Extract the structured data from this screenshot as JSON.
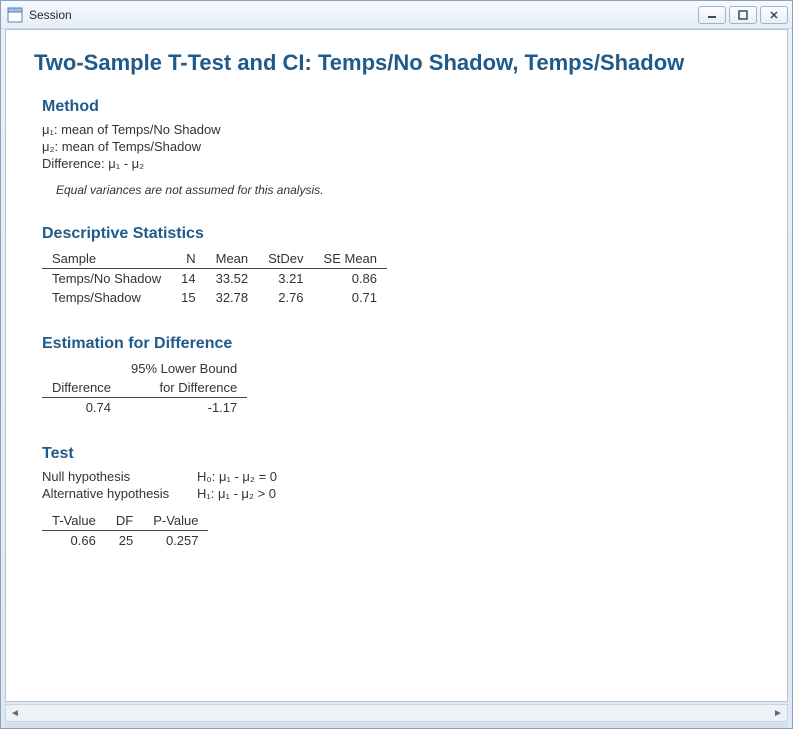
{
  "window": {
    "title": "Session"
  },
  "main_title": "Two-Sample T-Test and CI: Temps/No Shadow, Temps/Shadow",
  "method": {
    "heading": "Method",
    "mu1": "μ₁: mean of Temps/No Shadow",
    "mu2": "μ₂: mean of Temps/Shadow",
    "diff": "Difference: μ₁ - μ₂",
    "note": "Equal variances are not assumed for this analysis."
  },
  "descriptive": {
    "heading": "Descriptive Statistics",
    "headers": {
      "sample": "Sample",
      "n": "N",
      "mean": "Mean",
      "stdev": "StDev",
      "semean": "SE Mean"
    },
    "rows": [
      {
        "sample": "Temps/No Shadow",
        "n": "14",
        "mean": "33.52",
        "stdev": "3.21",
        "semean": "0.86"
      },
      {
        "sample": "Temps/Shadow",
        "n": "15",
        "mean": "32.78",
        "stdev": "2.76",
        "semean": "0.71"
      }
    ]
  },
  "estimation": {
    "heading": "Estimation for Difference",
    "h1": "Difference",
    "h2a": "95% Lower Bound",
    "h2b": "for Difference",
    "diff": "0.74",
    "lower": "-1.17"
  },
  "test": {
    "heading": "Test",
    "null_label": "Null hypothesis",
    "null_val": "H₀: μ₁ - μ₂ = 0",
    "alt_label": "Alternative hypothesis",
    "alt_val": "H₁: μ₁ - μ₂ > 0",
    "headers": {
      "t": "T-Value",
      "df": "DF",
      "p": "P-Value"
    },
    "row": {
      "t": "0.66",
      "df": "25",
      "p": "0.257"
    }
  }
}
